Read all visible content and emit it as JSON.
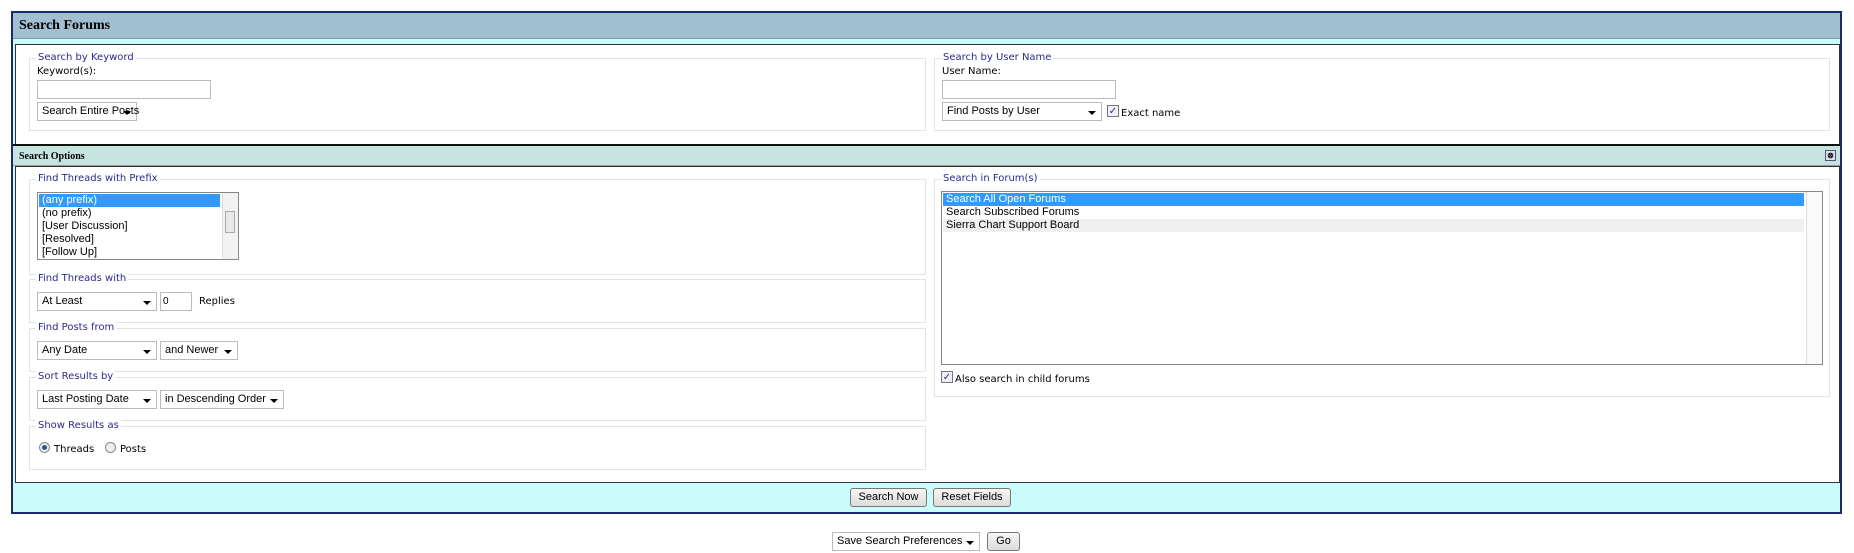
{
  "header": {
    "title": "Search Forums"
  },
  "keyword": {
    "legend": "Search by Keyword",
    "label": "Keyword(s):",
    "value": "",
    "mode": "Search Entire Posts"
  },
  "user": {
    "legend": "Search by User Name",
    "label": "User Name:",
    "value": "",
    "mode": "Find Posts by User",
    "exact_label": "Exact name",
    "exact_checked": true
  },
  "options": {
    "title": "Search Options",
    "collapse_icon": "collapse-icon"
  },
  "prefix": {
    "legend": "Find Threads with Prefix",
    "items": [
      "(any prefix)",
      "(no prefix)",
      "[User Discussion]",
      "[Resolved]",
      "[Follow Up]"
    ],
    "selected": 0
  },
  "threads_with": {
    "legend": "Find Threads with",
    "mode": "At Least",
    "count": "0",
    "suffix": "Replies"
  },
  "posts_from": {
    "legend": "Find Posts from",
    "date": "Any Date",
    "direction": "and Newer"
  },
  "sort": {
    "legend": "Sort Results by",
    "field": "Last Posting Date",
    "order": "in Descending Order"
  },
  "show_as": {
    "legend": "Show Results as",
    "threads": "Threads",
    "posts": "Posts",
    "selected": "Threads"
  },
  "forums": {
    "legend": "Search in Forum(s)",
    "items": [
      "Search All Open Forums",
      "Search Subscribed Forums",
      "Sierra Chart Support Board"
    ],
    "selected": 0,
    "child_label": "Also search in child forums",
    "child_checked": true
  },
  "actions": {
    "search": "Search Now",
    "reset": "Reset Fields"
  },
  "prefs": {
    "select": "Save Search Preferences",
    "go": "Go"
  }
}
